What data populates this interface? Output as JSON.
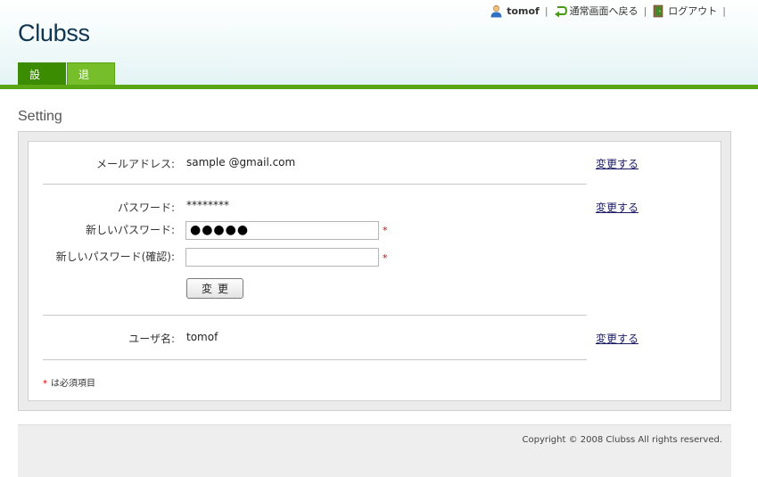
{
  "app": {
    "name": "Clubss"
  },
  "topnav": {
    "username": "tomof",
    "back_label": "通常画面へ戻る",
    "logout_label": "ログアウト",
    "separator": "|"
  },
  "tabs": [
    {
      "label": "設定",
      "active": true
    },
    {
      "label": "退会",
      "active": false
    }
  ],
  "page": {
    "title": "Setting"
  },
  "settings": {
    "email": {
      "label": "メールアドレス:",
      "value": "sample @gmail.com",
      "change_label": "変更する"
    },
    "password": {
      "label": "パスワード:",
      "value": "********",
      "change_label": "変更する",
      "new_label": "新しいパスワード:",
      "new_value": "●●●●●",
      "confirm_label": "新しいパスワード(確認):",
      "confirm_value": "",
      "required_mark": "*",
      "submit_label": "変更"
    },
    "username": {
      "label": "ユーザ名:",
      "value": "tomof",
      "change_label": "変更する"
    },
    "required_note": {
      "mark": "*",
      "text": "は必須項目"
    }
  },
  "footer": {
    "copyright": "Copyright © 2008 Clubss All rights reserved."
  },
  "colors": {
    "brand_green": "#5aa514",
    "tab_active": "#3b8c00",
    "tab_inactive": "#77bf2a",
    "title_text": "#0f3550",
    "required_red": "#e00000"
  },
  "icons": {
    "user": "user-icon",
    "back": "back-arrow-icon",
    "logout": "logout-door-icon"
  }
}
